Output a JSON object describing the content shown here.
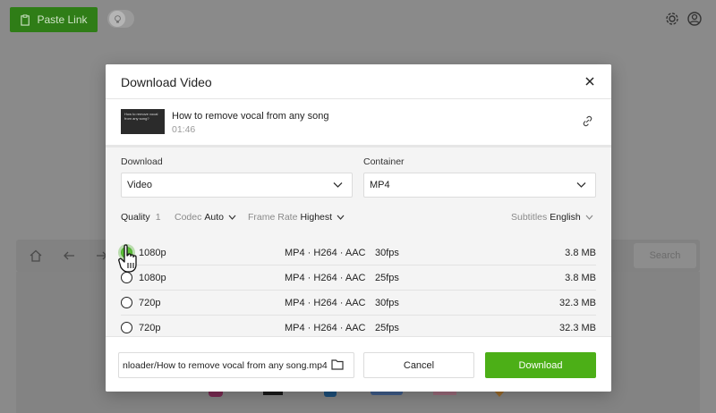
{
  "app": {
    "paste_link_label": "Paste Link",
    "search_label": "Search"
  },
  "modal": {
    "title": "Download Video",
    "video": {
      "title": "How to remove vocal from any song",
      "duration": "01:46",
      "thumbnail_text": "How to remove vocal from any song?"
    },
    "download_label": "Download",
    "download_value": "Video",
    "container_label": "Container",
    "container_value": "MP4",
    "quality": {
      "label": "Quality",
      "count": "1",
      "codec_label": "Codec",
      "codec_value": "Auto",
      "framerate_label": "Frame Rate",
      "framerate_value": "Highest",
      "subtitles_label": "Subtitles",
      "subtitles_value": "English"
    },
    "rows": [
      {
        "resolution": "1080p",
        "format": "MP4 · H264 · AAC",
        "fps": "30fps",
        "size": "3.8 MB",
        "selected": true
      },
      {
        "resolution": "1080p",
        "format": "MP4 · H264 · AAC",
        "fps": "25fps",
        "size": "3.8 MB",
        "selected": false
      },
      {
        "resolution": "720p",
        "format": "MP4 · H264 · AAC",
        "fps": "30fps",
        "size": "32.3 MB",
        "selected": false
      },
      {
        "resolution": "720p",
        "format": "MP4 · H264 · AAC",
        "fps": "25fps",
        "size": "32.3 MB",
        "selected": false
      }
    ],
    "footer": {
      "path": "nloader/How to remove vocal from any song.mp4",
      "cancel_label": "Cancel",
      "download_label": "Download"
    }
  },
  "colors": {
    "accent": "#4caf17",
    "paste_button": "#2f7d17",
    "overlay": "#8a8a8a"
  }
}
